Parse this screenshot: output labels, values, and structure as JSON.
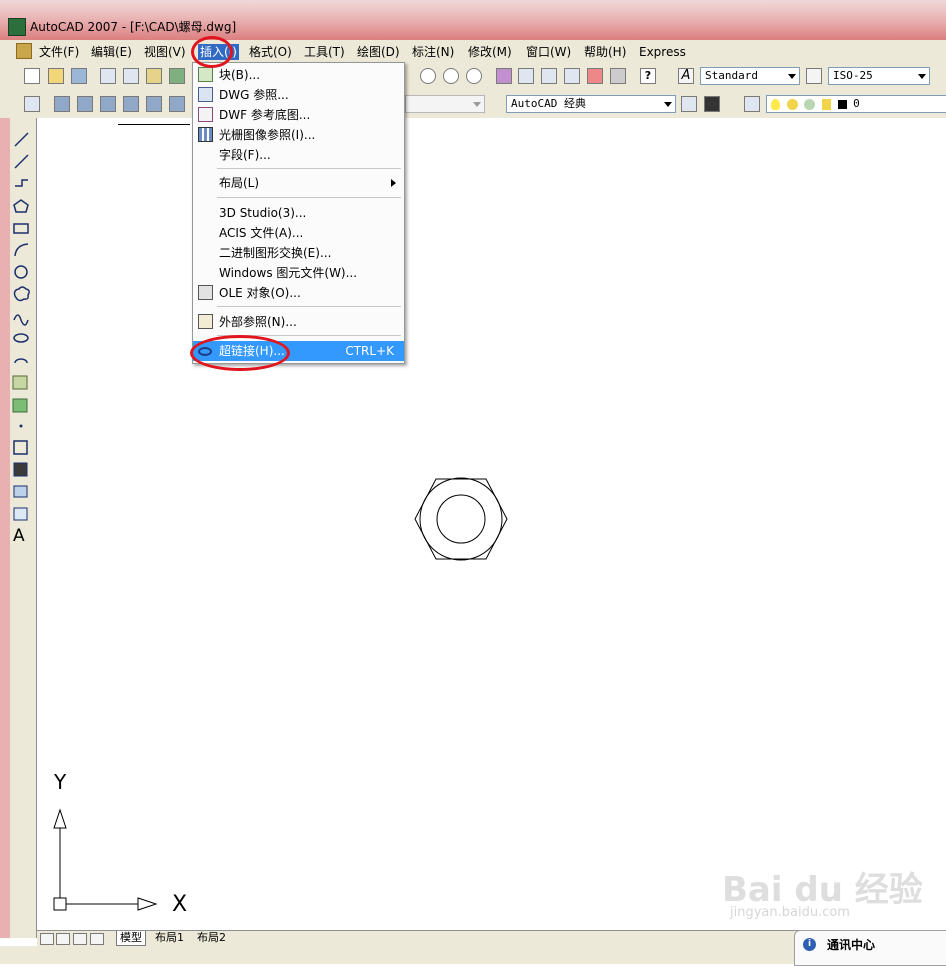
{
  "title_bar": {
    "title": "AutoCAD 2007 - [F:\\CAD\\螺母.dwg]"
  },
  "menu": [
    {
      "label": "文件(F)"
    },
    {
      "label": "编辑(E)"
    },
    {
      "label": "视图(V)"
    },
    {
      "label": "插入(I)"
    },
    {
      "label": "格式(O)"
    },
    {
      "label": "工具(T)"
    },
    {
      "label": "绘图(D)"
    },
    {
      "label": "标注(N)"
    },
    {
      "label": "修改(M)"
    },
    {
      "label": "窗口(W)"
    },
    {
      "label": "帮助(H)"
    },
    {
      "label": "Express"
    }
  ],
  "toolbar": {
    "text_style": "Standard",
    "dim_style": "ISO-25",
    "workspace": "AutoCAD 经典",
    "layer": "0"
  },
  "insert_menu": {
    "items": [
      {
        "label": "块(B)...",
        "icon": "block-icon"
      },
      {
        "label": "DWG 参照...",
        "icon": "dwg-reference-icon"
      },
      {
        "label": "DWF 参考底图...",
        "icon": "dwf-underlay-icon"
      },
      {
        "label": "光栅图像参照(I)...",
        "icon": "raster-image-icon"
      },
      {
        "label": "字段(F)..."
      },
      {
        "label": "布局(L)"
      },
      {
        "label": "3D Studio(3)..."
      },
      {
        "label": "ACIS 文件(A)..."
      },
      {
        "label": "二进制图形交换(E)..."
      },
      {
        "label": "Windows 图元文件(W)..."
      },
      {
        "label": "OLE 对象(O)...",
        "icon": "ole-object-icon"
      },
      {
        "label": "外部参照(N)...",
        "icon": "xref-icon"
      },
      {
        "label": "超链接(H)...",
        "shortcut": "CTRL+K",
        "icon": "hyperlink-icon"
      }
    ]
  },
  "layout_tabs": [
    {
      "label": "模型"
    },
    {
      "label": "布局1"
    },
    {
      "label": "布局2"
    }
  ],
  "ucs": {
    "x_label": "X",
    "y_label": "Y"
  },
  "left_toolbar": {
    "text_tool": "A"
  },
  "watermark": {
    "text": "Bai du 经验",
    "url": "jingyan.baidu.com"
  },
  "notification": {
    "title": "通讯中心"
  },
  "colors": {
    "highlight": "#3399ff",
    "annotation_red": "#e0151d",
    "titlebar": "#e9b5b5"
  }
}
